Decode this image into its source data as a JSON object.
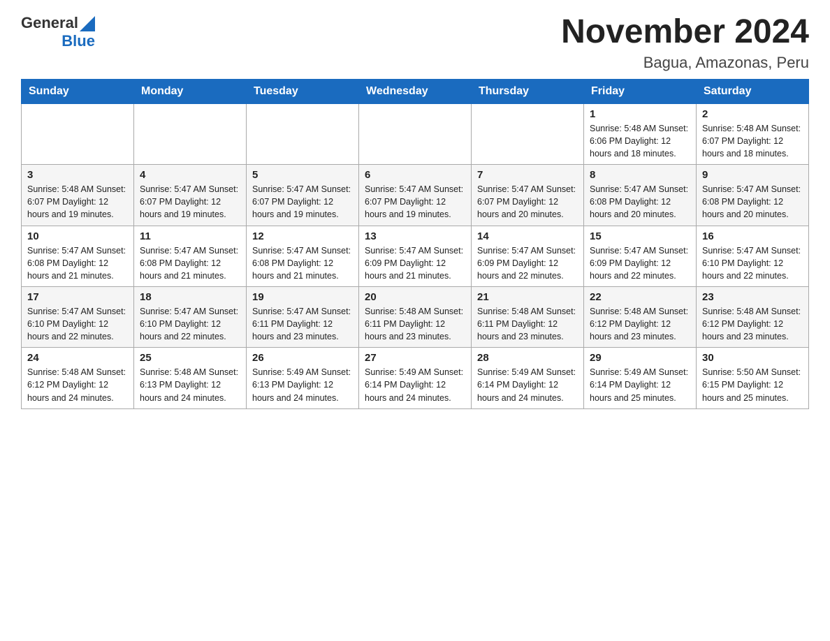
{
  "header": {
    "logo_general": "General",
    "logo_blue": "Blue",
    "title": "November 2024",
    "subtitle": "Bagua, Amazonas, Peru"
  },
  "days_of_week": [
    "Sunday",
    "Monday",
    "Tuesday",
    "Wednesday",
    "Thursday",
    "Friday",
    "Saturday"
  ],
  "weeks": [
    {
      "days": [
        {
          "num": "",
          "info": ""
        },
        {
          "num": "",
          "info": ""
        },
        {
          "num": "",
          "info": ""
        },
        {
          "num": "",
          "info": ""
        },
        {
          "num": "",
          "info": ""
        },
        {
          "num": "1",
          "info": "Sunrise: 5:48 AM\nSunset: 6:06 PM\nDaylight: 12 hours\nand 18 minutes."
        },
        {
          "num": "2",
          "info": "Sunrise: 5:48 AM\nSunset: 6:07 PM\nDaylight: 12 hours\nand 18 minutes."
        }
      ]
    },
    {
      "days": [
        {
          "num": "3",
          "info": "Sunrise: 5:48 AM\nSunset: 6:07 PM\nDaylight: 12 hours\nand 19 minutes."
        },
        {
          "num": "4",
          "info": "Sunrise: 5:47 AM\nSunset: 6:07 PM\nDaylight: 12 hours\nand 19 minutes."
        },
        {
          "num": "5",
          "info": "Sunrise: 5:47 AM\nSunset: 6:07 PM\nDaylight: 12 hours\nand 19 minutes."
        },
        {
          "num": "6",
          "info": "Sunrise: 5:47 AM\nSunset: 6:07 PM\nDaylight: 12 hours\nand 19 minutes."
        },
        {
          "num": "7",
          "info": "Sunrise: 5:47 AM\nSunset: 6:07 PM\nDaylight: 12 hours\nand 20 minutes."
        },
        {
          "num": "8",
          "info": "Sunrise: 5:47 AM\nSunset: 6:08 PM\nDaylight: 12 hours\nand 20 minutes."
        },
        {
          "num": "9",
          "info": "Sunrise: 5:47 AM\nSunset: 6:08 PM\nDaylight: 12 hours\nand 20 minutes."
        }
      ]
    },
    {
      "days": [
        {
          "num": "10",
          "info": "Sunrise: 5:47 AM\nSunset: 6:08 PM\nDaylight: 12 hours\nand 21 minutes."
        },
        {
          "num": "11",
          "info": "Sunrise: 5:47 AM\nSunset: 6:08 PM\nDaylight: 12 hours\nand 21 minutes."
        },
        {
          "num": "12",
          "info": "Sunrise: 5:47 AM\nSunset: 6:08 PM\nDaylight: 12 hours\nand 21 minutes."
        },
        {
          "num": "13",
          "info": "Sunrise: 5:47 AM\nSunset: 6:09 PM\nDaylight: 12 hours\nand 21 minutes."
        },
        {
          "num": "14",
          "info": "Sunrise: 5:47 AM\nSunset: 6:09 PM\nDaylight: 12 hours\nand 22 minutes."
        },
        {
          "num": "15",
          "info": "Sunrise: 5:47 AM\nSunset: 6:09 PM\nDaylight: 12 hours\nand 22 minutes."
        },
        {
          "num": "16",
          "info": "Sunrise: 5:47 AM\nSunset: 6:10 PM\nDaylight: 12 hours\nand 22 minutes."
        }
      ]
    },
    {
      "days": [
        {
          "num": "17",
          "info": "Sunrise: 5:47 AM\nSunset: 6:10 PM\nDaylight: 12 hours\nand 22 minutes."
        },
        {
          "num": "18",
          "info": "Sunrise: 5:47 AM\nSunset: 6:10 PM\nDaylight: 12 hours\nand 22 minutes."
        },
        {
          "num": "19",
          "info": "Sunrise: 5:47 AM\nSunset: 6:11 PM\nDaylight: 12 hours\nand 23 minutes."
        },
        {
          "num": "20",
          "info": "Sunrise: 5:48 AM\nSunset: 6:11 PM\nDaylight: 12 hours\nand 23 minutes."
        },
        {
          "num": "21",
          "info": "Sunrise: 5:48 AM\nSunset: 6:11 PM\nDaylight: 12 hours\nand 23 minutes."
        },
        {
          "num": "22",
          "info": "Sunrise: 5:48 AM\nSunset: 6:12 PM\nDaylight: 12 hours\nand 23 minutes."
        },
        {
          "num": "23",
          "info": "Sunrise: 5:48 AM\nSunset: 6:12 PM\nDaylight: 12 hours\nand 23 minutes."
        }
      ]
    },
    {
      "days": [
        {
          "num": "24",
          "info": "Sunrise: 5:48 AM\nSunset: 6:12 PM\nDaylight: 12 hours\nand 24 minutes."
        },
        {
          "num": "25",
          "info": "Sunrise: 5:48 AM\nSunset: 6:13 PM\nDaylight: 12 hours\nand 24 minutes."
        },
        {
          "num": "26",
          "info": "Sunrise: 5:49 AM\nSunset: 6:13 PM\nDaylight: 12 hours\nand 24 minutes."
        },
        {
          "num": "27",
          "info": "Sunrise: 5:49 AM\nSunset: 6:14 PM\nDaylight: 12 hours\nand 24 minutes."
        },
        {
          "num": "28",
          "info": "Sunrise: 5:49 AM\nSunset: 6:14 PM\nDaylight: 12 hours\nand 24 minutes."
        },
        {
          "num": "29",
          "info": "Sunrise: 5:49 AM\nSunset: 6:14 PM\nDaylight: 12 hours\nand 25 minutes."
        },
        {
          "num": "30",
          "info": "Sunrise: 5:50 AM\nSunset: 6:15 PM\nDaylight: 12 hours\nand 25 minutes."
        }
      ]
    }
  ]
}
